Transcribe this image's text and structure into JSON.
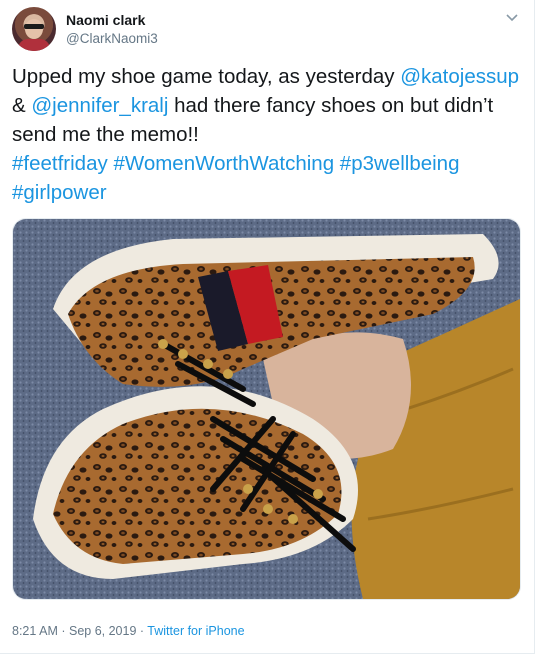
{
  "author": {
    "name": "Naomi clark",
    "handle": "@ClarkNaomi3"
  },
  "tweet": {
    "text_1": "Upped my shoe game today, as yesterday ",
    "mention_1": "@katojessup",
    "text_2": "& ",
    "mention_2": "@jennifer_kralj",
    "text_3": " had there fancy shoes on but didn’t send me the memo!!",
    "hashtags": [
      "#feetfriday",
      "#WomenWorthWatching",
      "#p3wellbeing",
      "#girlpower"
    ]
  },
  "media": {
    "description_icon": "photo-shoes"
  },
  "meta": {
    "time": "8:21 AM",
    "separator": " · ",
    "date": "Sep 6, 2019",
    "source": "Twitter for iPhone"
  },
  "colors": {
    "link": "#1b95e0",
    "secondary_text": "#657786",
    "primary_text": "#14171a"
  }
}
